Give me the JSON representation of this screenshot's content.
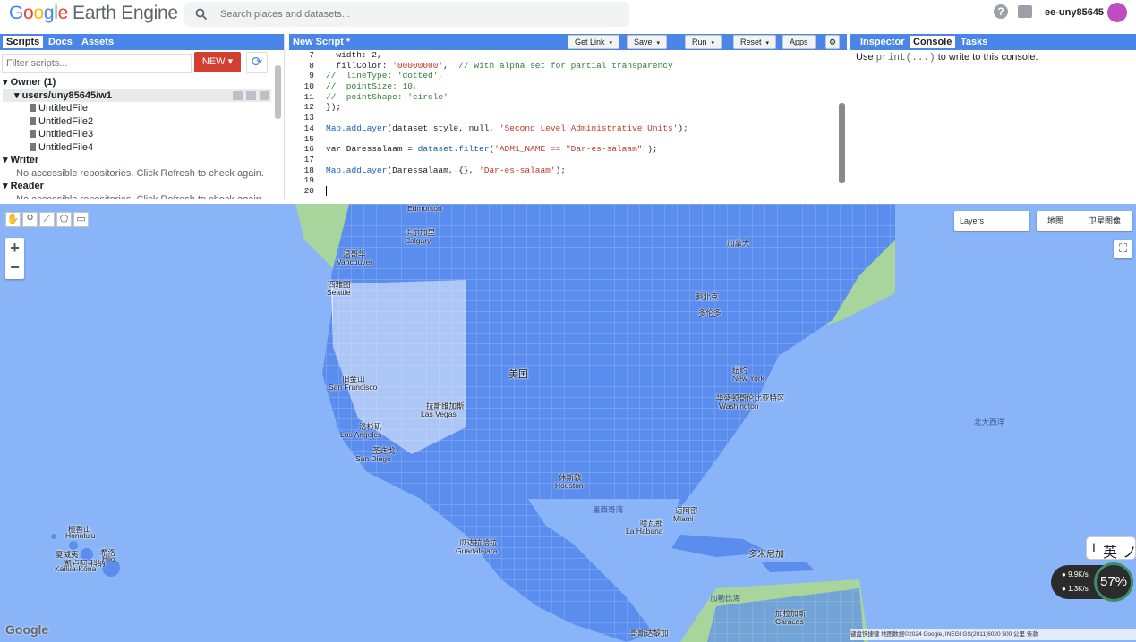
{
  "header": {
    "logo_google": [
      "G",
      "o",
      "o",
      "g",
      "l",
      "e"
    ],
    "logo_product": "Earth Engine",
    "search_placeholder": "Search places and datasets...",
    "user": "ee-uny85645"
  },
  "left_panel": {
    "tabs": [
      "Scripts",
      "Docs",
      "Assets"
    ],
    "filter_placeholder": "Filter scripts...",
    "new_label": "NEW",
    "tree": {
      "owner": "Owner (1)",
      "repo": "users/uny85645/w1",
      "files": [
        "UntitledFile",
        "UntitledFile2",
        "UntitledFile3",
        "UntitledFile4"
      ],
      "writer": "Writer",
      "writer_msg": "No accessible repositories. Click Refresh to check again.",
      "reader": "Reader",
      "reader_msg": "No accessible repositories. Click Refresh to check again."
    }
  },
  "editor": {
    "title": "New Script *",
    "buttons": {
      "get_link": "Get Link",
      "save": "Save",
      "run": "Run",
      "reset": "Reset",
      "apps": "Apps"
    },
    "lines": [
      {
        "n": "7",
        "code": "  width: 2,"
      },
      {
        "n": "8",
        "code": "  fillColor: '00000000',  // with alpha set for partial transparency"
      },
      {
        "n": "9",
        "code": "//  lineType: 'dotted',"
      },
      {
        "n": "10",
        "code": "//  pointSize: 10,"
      },
      {
        "n": "11",
        "code": "//  pointShape: 'circle'"
      },
      {
        "n": "12",
        "code": "});"
      },
      {
        "n": "13",
        "code": ""
      },
      {
        "n": "14",
        "code": "Map.addLayer(dataset_style, null, 'Second Level Administrative Units');"
      },
      {
        "n": "15",
        "code": ""
      },
      {
        "n": "16",
        "code": "var Daressalaam = dataset.filter('ADM1_NAME == \"Dar-es-salaam\"');"
      },
      {
        "n": "17",
        "code": ""
      },
      {
        "n": "18",
        "code": "Map.addLayer(Daressalaam, {}, 'Dar-es-salaam');"
      },
      {
        "n": "19",
        "code": ""
      },
      {
        "n": "20",
        "code": ""
      }
    ]
  },
  "right_panel": {
    "tabs": [
      "Inspector",
      "Console",
      "Tasks"
    ],
    "console_pre": "Use ",
    "console_code": "print(...)",
    "console_post": " to write to this console."
  },
  "map": {
    "layers_label": "Layers",
    "map_type": [
      "地图",
      "卫星图像"
    ],
    "cities": [
      {
        "name": "Edmonton",
        "k": "edm"
      },
      {
        "name": "卡尔加里",
        "k": "calg_zh"
      },
      {
        "name": "Calgary",
        "k": "calg"
      },
      {
        "name": "温哥华",
        "k": "van_zh"
      },
      {
        "name": "Vancouver",
        "k": "van"
      },
      {
        "name": "西雅图",
        "k": "sea_zh"
      },
      {
        "name": "Seattle",
        "k": "sea"
      },
      {
        "name": "美国",
        "k": "us"
      },
      {
        "name": "旧金山",
        "k": "sf_zh"
      },
      {
        "name": "San Francisco",
        "k": "sf"
      },
      {
        "name": "拉斯维加斯",
        "k": "lv_zh"
      },
      {
        "name": "Las Vegas",
        "k": "lv"
      },
      {
        "name": "洛杉矶",
        "k": "la_zh"
      },
      {
        "name": "Los Angeles",
        "k": "la"
      },
      {
        "name": "圣迭戈",
        "k": "sd_zh"
      },
      {
        "name": "San Diego",
        "k": "sd"
      },
      {
        "name": "休斯敦",
        "k": "hou_zh"
      },
      {
        "name": "Houston",
        "k": "hou"
      },
      {
        "name": "墨西哥湾",
        "k": "gulf"
      },
      {
        "name": "迈阿密",
        "k": "mia_zh"
      },
      {
        "name": "Miami",
        "k": "mia"
      },
      {
        "name": "哈瓦那",
        "k": "hav_zh"
      },
      {
        "name": "La Habana",
        "k": "hav"
      },
      {
        "name": "瓜达拉哈拉",
        "k": "gua_zh"
      },
      {
        "name": "Guadalajara",
        "k": "gua"
      },
      {
        "name": "多米尼加",
        "k": "dom"
      },
      {
        "name": "加勒比海",
        "k": "car"
      },
      {
        "name": "加拉加斯",
        "k": "ccs_zh"
      },
      {
        "name": "Caracas",
        "k": "ccs"
      },
      {
        "name": "纽约",
        "k": "ny_zh"
      },
      {
        "name": "New York",
        "k": "ny"
      },
      {
        "name": "华盛顿哥伦比亚特区",
        "k": "dc_zh"
      },
      {
        "name": "Washington",
        "k": "dc"
      },
      {
        "name": "魁北克",
        "k": "qc"
      },
      {
        "name": "加拿大",
        "k": "ca"
      },
      {
        "name": "檀香山",
        "k": "hnl_zh"
      },
      {
        "name": "Honolulu",
        "k": "hnl"
      },
      {
        "name": "夏威夷",
        "k": "hi"
      },
      {
        "name": "凯卢阿-科纳",
        "k": "kona_zh"
      },
      {
        "name": "Kailua-Kona",
        "k": "kona"
      },
      {
        "name": "希洛",
        "k": "hilo_zh"
      },
      {
        "name": "Hilo",
        "k": "hilo"
      },
      {
        "name": "哥斯达黎加",
        "k": "cr"
      },
      {
        "name": "多伦多",
        "k": "tor"
      }
    ],
    "ocean": "北大西洋",
    "watermark": "Google",
    "attribution": "键盘快捷键  地图数据©2024 Google, INEGI GS(2011)6020  500 公里  条款",
    "ime": [
      "I",
      "英",
      "ノ"
    ],
    "net_up": "9.9K/s",
    "net_down": "1.3K/s",
    "net_percent": "57%"
  }
}
